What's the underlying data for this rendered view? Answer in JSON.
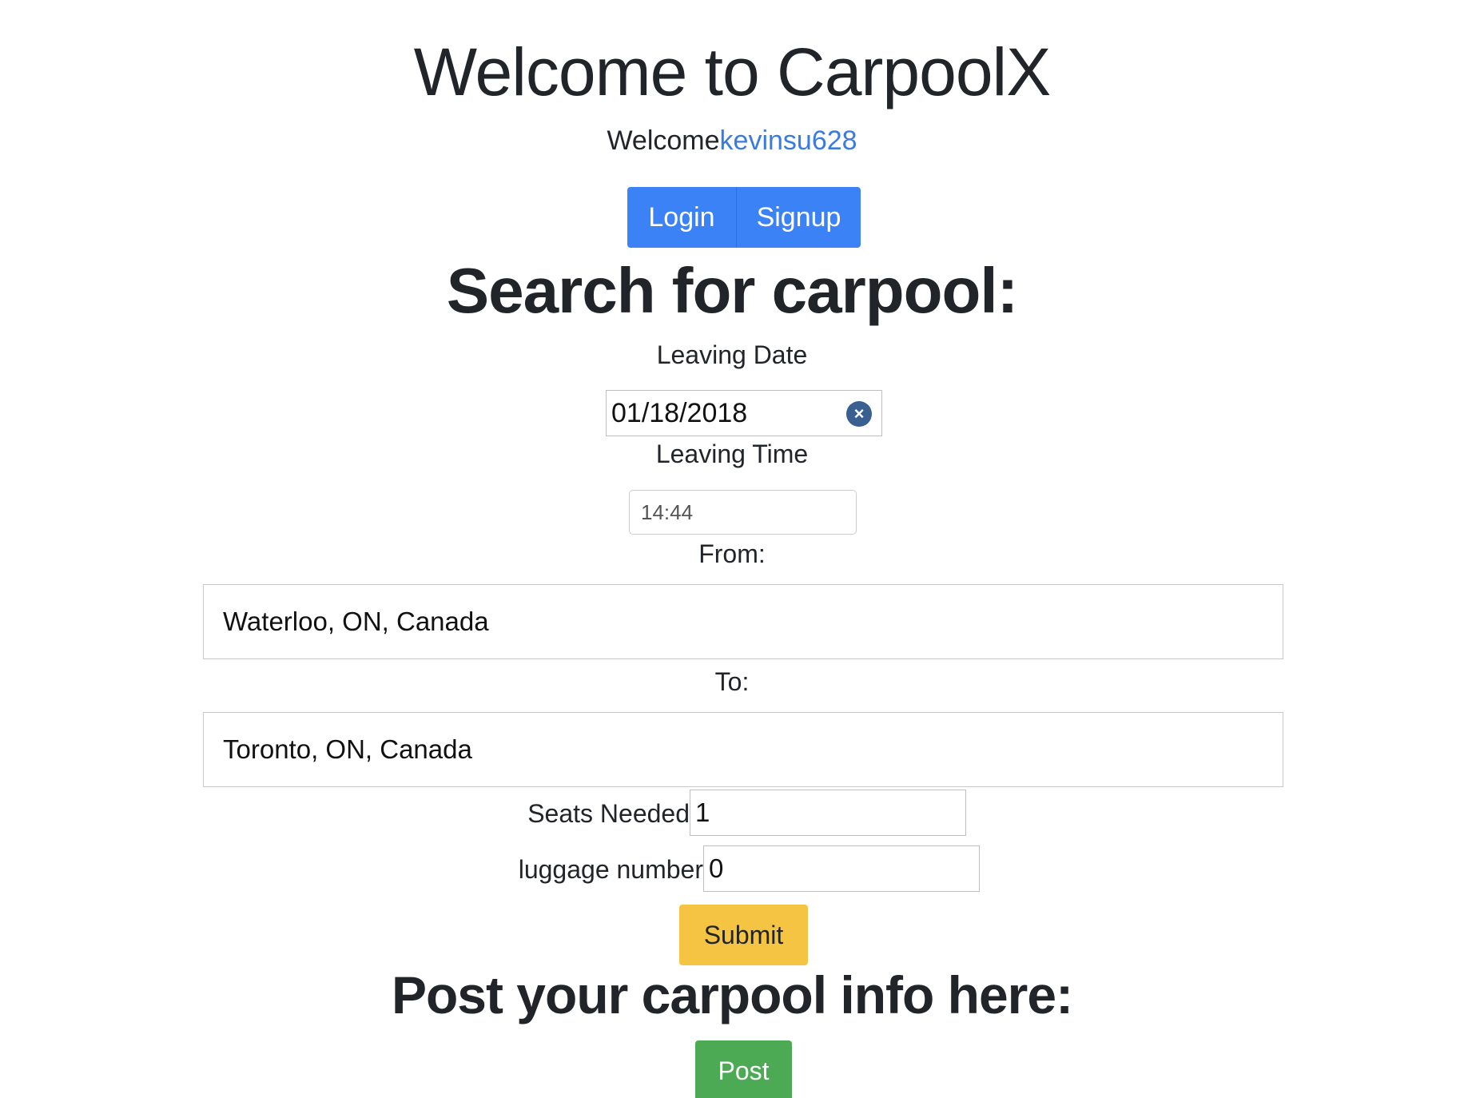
{
  "header": {
    "title": "Welcome to CarpoolX",
    "welcome_prefix": "Welcome",
    "username": "kevinsu628"
  },
  "auth": {
    "login_label": "Login",
    "signup_label": "Signup"
  },
  "search": {
    "heading": "Search for carpool:",
    "leaving_date_label": "Leaving Date",
    "leaving_date_value": "01/18/2018",
    "leaving_time_label": "Leaving Time",
    "leaving_time_value": "14:44",
    "from_label": "From:",
    "from_value": "Waterloo, ON, Canada",
    "to_label": "To:",
    "to_value": "Toronto, ON, Canada",
    "seats_label": "Seats Needed",
    "seats_value": "1",
    "luggage_label": "luggage number",
    "luggage_value": "0",
    "submit_label": "Submit"
  },
  "post": {
    "heading": "Post your carpool info here:",
    "post_label": "Post"
  },
  "icons": {
    "date_clear": "clear-circle-icon"
  },
  "colors": {
    "primary": "#3b82f6",
    "warning": "#f6c443",
    "success": "#4caa55",
    "link": "#3b7be0"
  }
}
